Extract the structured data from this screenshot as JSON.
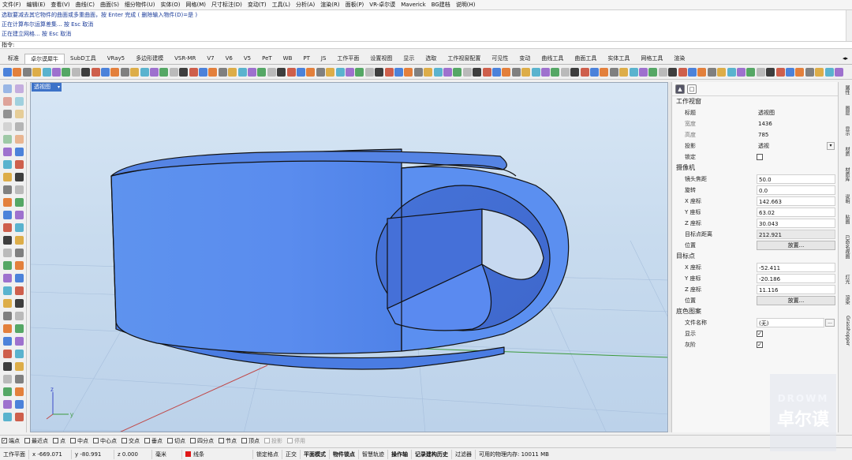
{
  "menu": [
    "文件(F)",
    "编辑(E)",
    "查看(V)",
    "曲线(C)",
    "曲面(S)",
    "细分物件(U)",
    "实体(O)",
    "网格(M)",
    "尺寸标注(D)",
    "变动(T)",
    "工具(L)",
    "分析(A)",
    "渲染(R)",
    "面板(P)",
    "VR-卓尔谟",
    "Maverick",
    "BG建档",
    "说明(H)"
  ],
  "command_history": [
    "选取要减去其它物件的曲面或多重曲面，按 Enter 完成 ( 删除输入物件(D)=是 )",
    "正在计算布尔运算差集... 按 Esc 取消",
    "正在建立网格... 按 Esc 取消"
  ],
  "command_prompt": "指令:",
  "tabs": [
    "标准",
    "卓尔谟犀牛",
    "SubD工具",
    "VRay5",
    "多边形建模",
    "VSR-MR",
    "V7",
    "V6",
    "V5",
    "PeT",
    "WB",
    "PT",
    "JS",
    "工作平面",
    "设置视图",
    "显示",
    "选取",
    "工作视窗配置",
    "可见性",
    "变动",
    "曲线工具",
    "曲面工具",
    "实体工具",
    "网格工具",
    "渲染"
  ],
  "active_tab_index": 1,
  "viewport": {
    "title": "透视图",
    "axis_x": "x",
    "axis_y": "y",
    "axis_z": "z",
    "object_color": "#5b8ff0",
    "grid_axis_x_color": "#c04a4a",
    "grid_axis_y_color": "#3c9a3c"
  },
  "panel": {
    "sections": {
      "viewport": "工作视窗",
      "camera": "摄像机",
      "target": "目标点",
      "wallpaper": "底色图案"
    },
    "viewport_props": [
      {
        "label": "标题",
        "value": "透视图",
        "style": "plain"
      },
      {
        "label": "宽度",
        "value": "1436",
        "style": "plain",
        "dim": true
      },
      {
        "label": "高度",
        "value": "785",
        "style": "plain",
        "dim": true
      },
      {
        "label": "投影",
        "value": "透视",
        "style": "dropdown"
      },
      {
        "label": "锁定",
        "value": "",
        "style": "checkbox",
        "checked": false
      }
    ],
    "camera_props": [
      {
        "label": "镜头焦距",
        "value": "50.0"
      },
      {
        "label": "旋转",
        "value": "0.0"
      },
      {
        "label": "X 座标",
        "value": "142.663"
      },
      {
        "label": "Y 座标",
        "value": "63.02"
      },
      {
        "label": "Z 座标",
        "value": "30.043"
      },
      {
        "label": "目标点距离",
        "value": "212.921",
        "gray": true
      },
      {
        "label": "位置",
        "value": "放置...",
        "button": true
      }
    ],
    "target_props": [
      {
        "label": "X 座标",
        "value": "-52.411"
      },
      {
        "label": "Y 座标",
        "value": "-20.186"
      },
      {
        "label": "Z 座标",
        "value": "11.116"
      },
      {
        "label": "位置",
        "value": "放置...",
        "button": true
      }
    ],
    "wallpaper_props": [
      {
        "label": "文件名称",
        "value": "(无)",
        "browse": "..."
      },
      {
        "label": "显示",
        "checked": true
      },
      {
        "label": "灰阶",
        "checked": true
      }
    ]
  },
  "side_tabs": [
    "属性",
    "图层",
    "显示",
    "材质",
    "材质库",
    "说明",
    "贴图",
    "已命名视图",
    "灯光",
    "渲染",
    "Grasshopper"
  ],
  "osnaps": [
    {
      "label": "端点",
      "checked": true
    },
    {
      "label": "最近点",
      "checked": false
    },
    {
      "label": "点",
      "checked": false
    },
    {
      "label": "中点",
      "checked": false
    },
    {
      "label": "中心点",
      "checked": false
    },
    {
      "label": "交点",
      "checked": false
    },
    {
      "label": "垂点",
      "checked": false
    },
    {
      "label": "切点",
      "checked": false
    },
    {
      "label": "四分点",
      "checked": false
    },
    {
      "label": "节点",
      "checked": false
    },
    {
      "label": "顶点",
      "checked": false
    },
    {
      "label": "投影",
      "checked": false,
      "disabled": true
    },
    {
      "label": "停用",
      "checked": false,
      "disabled": true
    }
  ],
  "status": {
    "cplane": "工作平面",
    "x": "x -669.071",
    "y": "y -80.991",
    "z": "z 0.000",
    "units": "毫米",
    "layer": "线条",
    "layer_color": "#e01818",
    "toggles": [
      "锁定格点",
      "正交",
      "平面模式",
      "物件锁点",
      "智慧轨迹",
      "操作轴",
      "记录建构历史",
      "过滤器"
    ],
    "bold_toggles": [
      "平面模式",
      "物件锁点",
      "操作轴",
      "记录建构历史"
    ],
    "memory": "可用的物理内存: 10011 MB"
  },
  "watermark": {
    "line1": "DROWM",
    "line2": "卓尔谟"
  }
}
